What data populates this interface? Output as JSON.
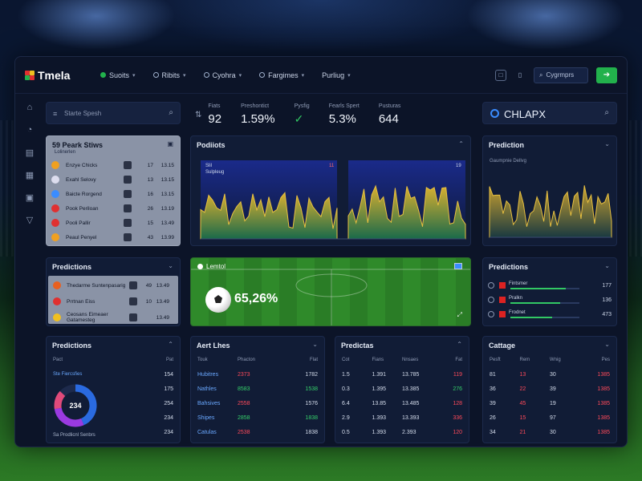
{
  "app": {
    "title": "Tmela"
  },
  "nav": [
    {
      "label": "Suoits",
      "dot": "#22b14c"
    },
    {
      "label": "Ribits",
      "dot": ""
    },
    {
      "label": "Cyohra",
      "dot": "#9fb0cc"
    },
    {
      "label": "Fargimes",
      "dot": "#9fb0cc"
    },
    {
      "label": "Purliug",
      "dot": ""
    }
  ],
  "top_search": {
    "placeholder": "Cygrmprs"
  },
  "sidebar_icons": [
    "home-icon",
    "clock-icon",
    "document-icon",
    "calendar-icon",
    "grid-icon",
    "chevron-icon"
  ],
  "search": {
    "placeholder": "Starte Spesh"
  },
  "stats": [
    {
      "label": "Fiats",
      "value": "92"
    },
    {
      "label": "Preshontict",
      "value": "1.59%"
    },
    {
      "label": "Pysfig",
      "value": "check"
    },
    {
      "label": "Fearls Spert",
      "value": "5.3%"
    },
    {
      "label": "Pusturas",
      "value": "644"
    }
  ],
  "brand_box": {
    "text": "CHLAPX"
  },
  "leaderboard": {
    "title": "59 Peark Stiws",
    "subtitle": "Lolinerlen",
    "rows": [
      {
        "name": "Enzye Chicks",
        "n1": "17",
        "n2": "13.15",
        "crest": "#f0a020"
      },
      {
        "name": "Exahl Selovy",
        "n1": "13",
        "n2": "13.15",
        "crest": "#dde"
      },
      {
        "name": "Baicte Rorgend",
        "n1": "16",
        "n2": "13.15",
        "crest": "#3a8cff"
      },
      {
        "name": "Pook Periloan",
        "n1": "26",
        "n2": "13.19",
        "crest": "#e03030"
      },
      {
        "name": "Pooli Pallir",
        "n1": "15",
        "n2": "13.49",
        "crest": "#e03030"
      },
      {
        "name": "Peaul Penyel",
        "n1": "43",
        "n2": "13.99",
        "crest": "#f0a020"
      }
    ]
  },
  "chart_main": {
    "title": "Podiiots",
    "legend": "Slil",
    "legend2": "Sulpleug",
    "badge1": "11",
    "badge2": "19"
  },
  "chart_right": {
    "title": "Prediction",
    "sub": "Gaumpnie Dellvg"
  },
  "predictions_mid": {
    "title": "Predictions",
    "rows": [
      {
        "name": "Thedarme Suntenpasarig",
        "n1": "49",
        "n2": "13.49",
        "crest": "#e86020"
      },
      {
        "name": "Prrtnan Eiss",
        "n1": "10",
        "n2": "13.49",
        "crest": "#e03030"
      },
      {
        "name": "Ceosans Eimeaer Gatamesteg",
        "n1": "",
        "n2": "13.49",
        "crest": "#f0c020"
      }
    ]
  },
  "pitch": {
    "label": "Lemtol",
    "percent": "65,26%"
  },
  "predictions_right": {
    "title": "Predictions",
    "rows": [
      {
        "name": "Fintsmer",
        "value": "177",
        "fill": 0.8
      },
      {
        "name": "Pralkn",
        "value": "136",
        "fill": 0.72
      },
      {
        "name": "Frodnet",
        "value": "473",
        "fill": 0.6
      }
    ]
  },
  "table1": {
    "title": "Predictions",
    "header": [
      "Pact",
      "Pat"
    ],
    "legend_top": "Ste Fiercsfies",
    "center_label": "234",
    "legend_bottom": "Sa Prodlicnl Senbrs",
    "rows": [
      {
        "c2": "154"
      },
      {
        "c2": "175"
      },
      {
        "c2": "254"
      },
      {
        "c2": "234"
      },
      {
        "c2": "234"
      }
    ]
  },
  "table2": {
    "title": "Aert Lhes",
    "header": [
      "Touk",
      "Phacton",
      "Flat"
    ],
    "rows": [
      {
        "c1": "Hubitres",
        "c2": "2373",
        "c3": "1782"
      },
      {
        "c1": "Nathles",
        "c2": "8583",
        "c3": "1538"
      },
      {
        "c1": "Bahsives",
        "c2": "2558",
        "c3": "1576"
      },
      {
        "c1": "Shipes",
        "c2": "2858",
        "c3": "1838"
      },
      {
        "c1": "Catulas",
        "c2": "2538",
        "c3": "1838"
      }
    ]
  },
  "table3": {
    "title": "Predictas",
    "header": [
      "Cot",
      "Fians",
      "Nnsaes",
      "Fat"
    ],
    "rows": [
      {
        "c1": "1.5",
        "c2": "1.391",
        "c3": "13.785",
        "c4": "119"
      },
      {
        "c1": "0.3",
        "c2": "1.395",
        "c3": "13.385",
        "c4": "276"
      },
      {
        "c1": "6.4",
        "c2": "13.85",
        "c3": "13.485",
        "c4": "128"
      },
      {
        "c1": "2.9",
        "c2": "1.393",
        "c3": "13.393",
        "c4": "336"
      },
      {
        "c1": "0.5",
        "c2": "1.393",
        "c3": "2.393",
        "c4": "120"
      }
    ]
  },
  "table4": {
    "title": "Cattage",
    "header": [
      "Pesft",
      "Rem",
      "Wnig",
      "Pes"
    ],
    "rows": [
      {
        "c1": "81",
        "c2": "13",
        "c3": "30",
        "c4": "1385"
      },
      {
        "c1": "36",
        "c2": "22",
        "c3": "39",
        "c4": "1385"
      },
      {
        "c1": "39",
        "c2": "45",
        "c3": "19",
        "c4": "1385"
      },
      {
        "c1": "26",
        "c2": "15",
        "c3": "97",
        "c4": "1385"
      },
      {
        "c1": "34",
        "c2": "21",
        "c3": "30",
        "c4": "1385"
      }
    ]
  },
  "colors": {
    "accent": "#22b14c",
    "positive": "#35d06a",
    "negative": "#ff4a5a",
    "panel": "#111c36"
  }
}
